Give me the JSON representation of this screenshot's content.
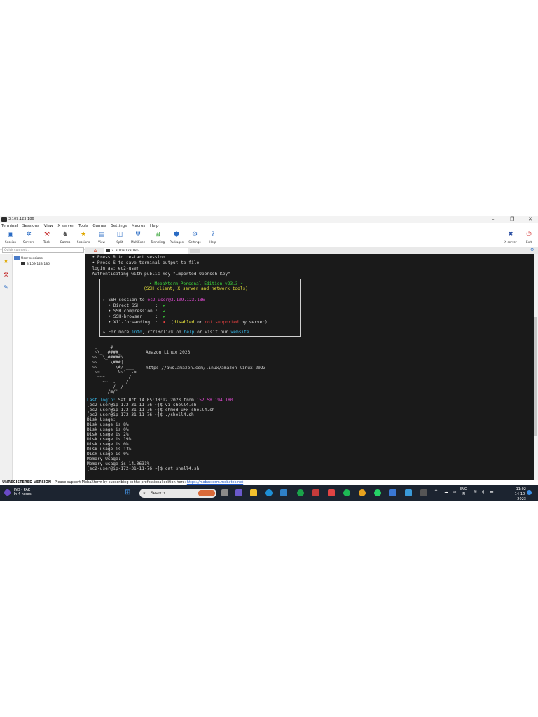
{
  "window": {
    "title": "3.109.123.186",
    "controls": [
      "–",
      "❐",
      "✕"
    ]
  },
  "menu": [
    "Terminal",
    "Sessions",
    "View",
    "X server",
    "Tools",
    "Games",
    "Settings",
    "Macros",
    "Help"
  ],
  "toolbar": {
    "buttons": [
      "Session",
      "Servers",
      "Tools",
      "Games",
      "Sessions",
      "View",
      "Split",
      "MultiExec",
      "Tunneling",
      "Packages",
      "Settings",
      "Help"
    ],
    "right_buttons": [
      "X server",
      "Exit"
    ]
  },
  "sidebar": {
    "quick_connect_placeholder": "Quick connect...",
    "folder": "User sessions",
    "session": "3.109.123.186"
  },
  "tabs": {
    "active": "2. 3.109.123.186"
  },
  "terminal": {
    "lines": [
      "  • Press R to restart session",
      "  • Press S to save terminal output to file",
      "  login as: ec2-user",
      "  Authenticating with public key \"Imported-Openssh-Key\""
    ],
    "banner_title": "• MobaXterm Personal Edition v23.3 •",
    "banner_subtitle": "(SSH client, X server and network tools)",
    "ssh_session_prefix": "▸ SSH session to ",
    "ssh_session_target": "ec2-user@3.109.123.186",
    "features": [
      {
        "label": "  • Direct SSH      :",
        "status": "✔"
      },
      {
        "label": "  • SSH compression :",
        "status": "✔"
      },
      {
        "label": "  • SSH-browser     :",
        "status": "✔"
      },
      {
        "label": "  • X11-forwarding  :",
        "status": "✘"
      }
    ],
    "x11_note_parts": [
      "(",
      "disabled",
      " or ",
      "not supported",
      " by server)"
    ],
    "more_info_parts": [
      "▸ For more ",
      "info",
      ", ctrl+click on ",
      "help",
      " or visit our ",
      "website",
      "."
    ],
    "ascii_art": [
      "   ,     #",
      "   ~\\_  ####_",
      "  ~~  \\_#####\\",
      "  ~~     \\###|",
      "  ~~       \\#/ ___",
      "   ~~       V~' '->",
      "    ~~~         /",
      "      ~~._.   _/",
      "         _/ _/",
      "       _/m/'"
    ],
    "os_name": "Amazon Linux 2023",
    "os_url": "https://aws.amazon.com/linux/amazon-linux-2023",
    "last_login_label": "Last login:",
    "last_login_text": " Sat Oct 14 05:30:12 2023 from ",
    "last_login_ip": "152.58.194.180",
    "commands": [
      "[ec2-user@ip-172-31-11-76 ~]$ vi shell4.sh",
      "[ec2-user@ip-172-31-11-76 ~]$ chmod u+x shell4.sh",
      "[ec2-user@ip-172-31-11-76 ~]$ ./shell4.sh",
      "Disk Usage:",
      "Disk usage is 8%",
      "Disk usage is 0%",
      "Disk usage is 2%",
      "Disk usage is 19%",
      "Disk usage is 0%",
      "Disk usage is 13%",
      "Disk usage is 0%",
      "Memory Usage:",
      "Memory usage is 14.0631%",
      "[ec2-user@ip-172-31-11-76 ~]$ cat shell4.sh"
    ]
  },
  "footer": {
    "unregistered_label": "UNREGISTERED VERSION",
    "message": "  -  Please support MobaXterm by subscribing to the professional edition here: ",
    "link": "https://mobaxterm.mobatek.net"
  },
  "taskbar": {
    "match_line1": "IND - PAK",
    "match_line2": "In 4 hours",
    "search_placeholder": "Search",
    "lang_line1": "ENG",
    "lang_line2": "IN",
    "time": "11:02",
    "date": "14-10-2023",
    "tray_chevron": "^"
  },
  "colors": {
    "terminal_bg": "#1a1a1a",
    "terminal_fg": "#d4d4d4",
    "accent_pink": "#e14bd3",
    "accent_cyan": "#36b6e6",
    "taskbar_bg": "#1c2430"
  }
}
